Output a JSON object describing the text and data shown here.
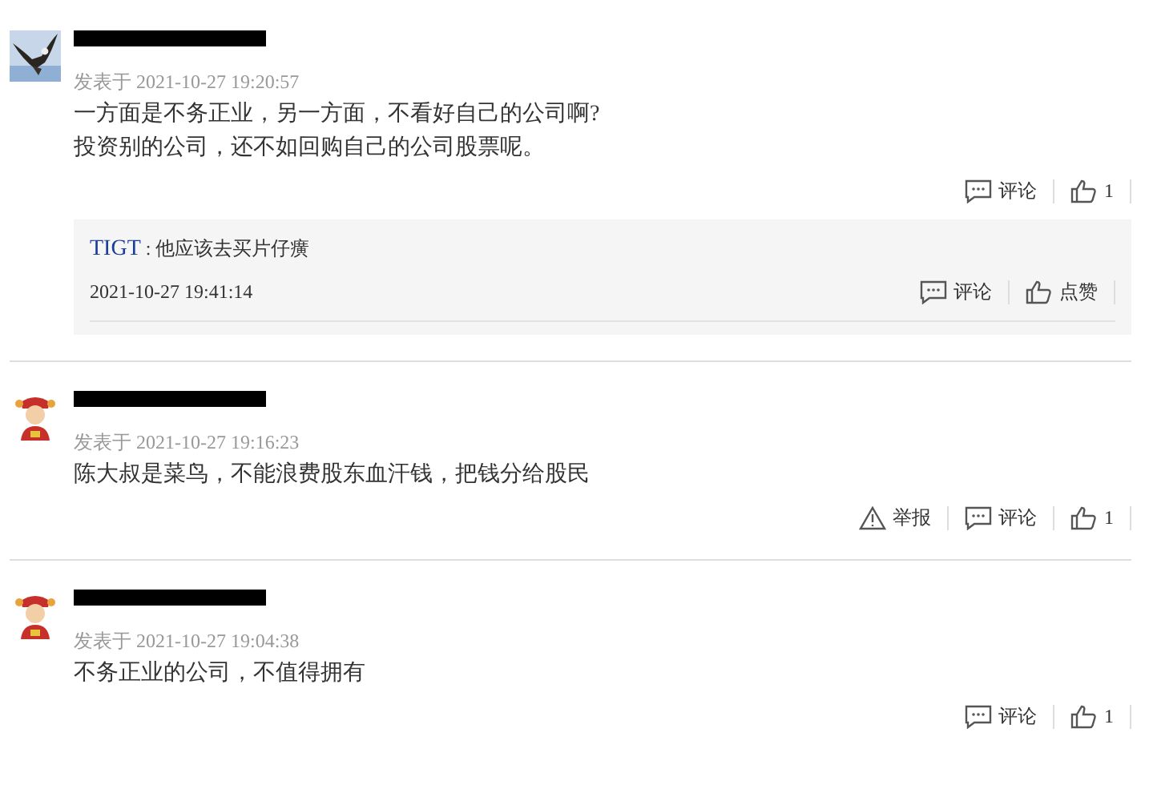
{
  "comments": [
    {
      "avatar": {
        "kind": "picture"
      },
      "posted": "发表于 2021-10-27 19:20:57",
      "body": [
        "一方面是不务正业，另一方面，不看好自己的公司啊?",
        "投资别的公司，还不如回购自己的公司股票呢。"
      ],
      "actions": [
        {
          "kind": "comment",
          "label": "评论"
        },
        {
          "kind": "like",
          "label": "1"
        }
      ],
      "replies": [
        {
          "user": "TIGT",
          "sep": ":",
          "text": "他应该去买片仔癀",
          "time": "2021-10-27 19:41:14",
          "actions": [
            {
              "kind": "comment",
              "label": "评论"
            },
            {
              "kind": "like",
              "label": "点赞"
            }
          ]
        }
      ]
    },
    {
      "avatar": {
        "kind": "picture"
      },
      "posted": "发表于 2021-10-27 19:16:23",
      "body": [
        "陈大叔是菜鸟，不能浪费股东血汗钱，把钱分给股民"
      ],
      "actions": [
        {
          "kind": "report",
          "label": "举报"
        },
        {
          "kind": "comment",
          "label": "评论"
        },
        {
          "kind": "like",
          "label": "1"
        }
      ]
    },
    {
      "avatar": {
        "kind": "picture"
      },
      "posted": "发表于 2021-10-27 19:04:38",
      "body": [
        "不务正业的公司，不值得拥有"
      ],
      "actions": [
        {
          "kind": "comment",
          "label": "评论"
        },
        {
          "kind": "like",
          "label": "1"
        }
      ]
    }
  ]
}
